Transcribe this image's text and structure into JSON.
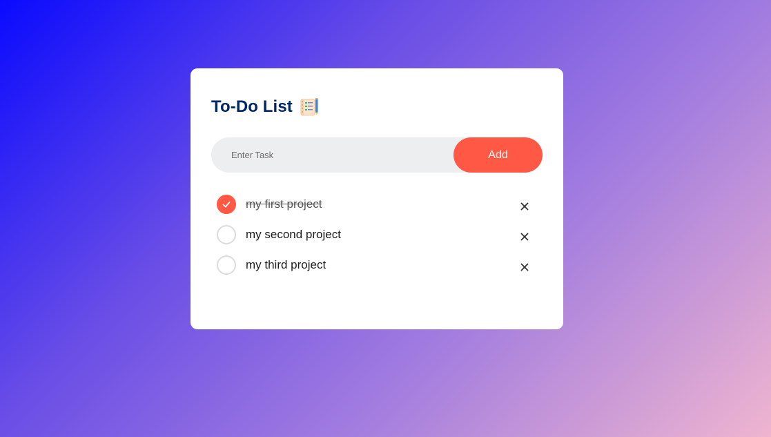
{
  "colors": {
    "accent": "#ff5945",
    "title": "#002765",
    "card": "#ffffff",
    "input_bg": "#edeef0"
  },
  "app": {
    "title": "To-Do List",
    "title_icon": "notepad-checklist-icon"
  },
  "input": {
    "placeholder": "Enter Task",
    "value": "",
    "add_label": "Add"
  },
  "tasks": [
    {
      "text": "my first project",
      "done": true,
      "delete_icon": "close-icon"
    },
    {
      "text": "my second project",
      "done": false,
      "delete_icon": "close-icon"
    },
    {
      "text": "my third project",
      "done": false,
      "delete_icon": "close-icon"
    }
  ]
}
